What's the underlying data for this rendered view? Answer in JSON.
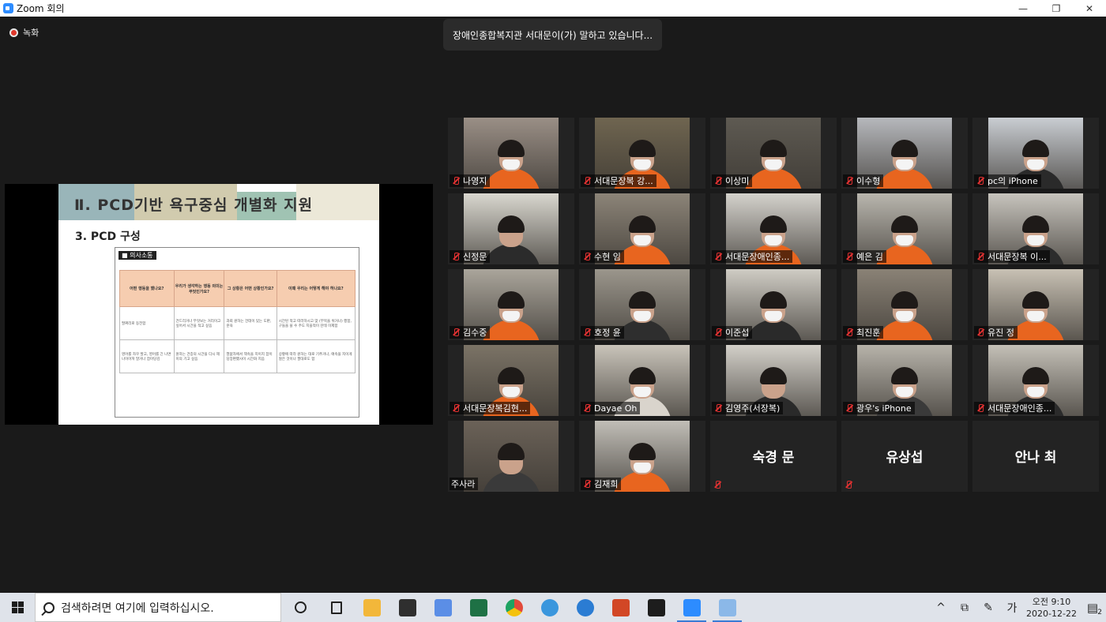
{
  "window": {
    "title": "Zoom 회의",
    "controls": [
      "—",
      "❐",
      "✕"
    ]
  },
  "recording": {
    "label": "녹화"
  },
  "speaking_banner": "장애인종합복지관 서대문이(가) 말하고 있습니다...",
  "shared_screen": {
    "slide_title": "Ⅱ. PCD기반 욕구중심 개별화 지원",
    "slide_subtitle": "3. PCD 구성",
    "box_tag": "■ 의사소통",
    "table_headers": [
      "어떤 행동을 했나요?",
      "우리가 생각하는 행동 의미는 무엇인가요?",
      "그 상황은 어떤 상황인가요?",
      "이때 우리는 어떻게 해야 하나요?"
    ],
    "table_rows": [
      [
        "팔짜리로 동전함",
        "건드리거나 무엇보는 거리이고 싶어서 시간을 적고 싶음",
        "과회 원하는 건데이 있는 도판, 훈육",
        "시간된 적고 따라하시고 맞 (부목을 위거나) 행함, 구들을 쓸 수 주도 지을적이 잔테 이제함"
      ],
      [
        "영어를 자꾸 발고, 영어를 긴 나면 나이어져 말거나 잡아당김",
        "원하는 건증의 시간을 다시 헤이의 기고 싶음",
        "열없자에서 잭속을 지이지 잡이 당장편했사이 시간화 지음",
        "상황에 따라 원하는 대로 기추거나, 애속을 지이게 않은 것이나 팔대로도 함"
      ]
    ]
  },
  "participants": [
    {
      "name": "나영지",
      "muted": true,
      "video": true,
      "bg": "#9a8f86",
      "shirt": "#e8651f",
      "mask": true
    },
    {
      "name": "서대문장복 강...",
      "muted": true,
      "video": true,
      "bg": "#6f6550",
      "shirt": "#e8651f",
      "mask": true
    },
    {
      "name": "이상미",
      "muted": true,
      "video": true,
      "bg": "#5e5a52",
      "shirt": "#e8651f",
      "mask": true
    },
    {
      "name": "이수형",
      "muted": true,
      "video": true,
      "bg": "#b6b8bc",
      "shirt": "#e8651f",
      "mask": true
    },
    {
      "name": "pc의 iPhone",
      "muted": true,
      "video": true,
      "bg": "#c9cdd2",
      "shirt": "#2a2a2a",
      "mask": true
    },
    {
      "name": "신정문",
      "muted": true,
      "video": true,
      "bg": "#d9d7cf",
      "shirt": "#2b2b2b",
      "mask": false
    },
    {
      "name": "수현 임",
      "muted": true,
      "video": true,
      "bg": "#8c8478",
      "shirt": "#e8651f",
      "mask": true
    },
    {
      "name": "서대문장애인종...",
      "muted": true,
      "video": true,
      "bg": "#d4d2cc",
      "shirt": "#e8651f",
      "mask": true
    },
    {
      "name": "예은 김",
      "muted": true,
      "video": true,
      "bg": "#b9b6ae",
      "shirt": "#e8651f",
      "mask": true
    },
    {
      "name": "서대문장복 이...",
      "muted": true,
      "video": true,
      "bg": "#c7c4bd",
      "shirt": "#2c2c2c",
      "mask": true
    },
    {
      "name": "김수중",
      "muted": true,
      "video": true,
      "bg": "#aaa59b",
      "shirt": "#e8651f",
      "mask": true
    },
    {
      "name": "호정 윤",
      "muted": true,
      "video": true,
      "bg": "#9b968c",
      "shirt": "#2e2e2e",
      "mask": true
    },
    {
      "name": "이준섭",
      "muted": true,
      "video": true,
      "bg": "#cfccc4",
      "shirt": "#2a2a2a",
      "mask": true
    },
    {
      "name": "최진훈",
      "muted": true,
      "video": true,
      "bg": "#8a8276",
      "shirt": "#e8651f",
      "mask": true
    },
    {
      "name": "유진 정",
      "muted": true,
      "video": true,
      "bg": "#c8c1b4",
      "shirt": "#e8651f",
      "mask": true
    },
    {
      "name": "서대문장복김현...",
      "muted": true,
      "video": true,
      "bg": "#7b7366",
      "shirt": "#e8651f",
      "mask": true
    },
    {
      "name": "Dayae Oh",
      "muted": true,
      "video": true,
      "bg": "#c9c4ba",
      "shirt": "#d9d4cc",
      "mask": true
    },
    {
      "name": "김영주(서장복)",
      "muted": true,
      "video": true,
      "bg": "#d3d0c9",
      "shirt": "#2a2a2a",
      "mask": false
    },
    {
      "name": "광우's iPhone",
      "muted": true,
      "video": true,
      "bg": "#b7b3aa",
      "shirt": "#3a3a3a",
      "mask": true
    },
    {
      "name": "서대문장애인종...",
      "muted": true,
      "video": true,
      "bg": "#c4c0b7",
      "shirt": "#2b2b2b",
      "mask": true
    },
    {
      "name": "주사라",
      "muted": false,
      "video": true,
      "bg": "#6b6258",
      "shirt": "#3a3a3a",
      "mask": false
    },
    {
      "name": "김재희",
      "muted": true,
      "video": true,
      "bg": "#c1beb7",
      "shirt": "#e8651f",
      "mask": true
    },
    {
      "name": "숙경 문",
      "muted": true,
      "video": false
    },
    {
      "name": "유상섭",
      "muted": true,
      "video": false
    },
    {
      "name": "안나 최",
      "muted": false,
      "video": false
    }
  ],
  "taskbar": {
    "search_placeholder": "검색하려면 여기에 입력하십시오.",
    "apps": [
      {
        "name": "cortana-icon",
        "color": "transparent"
      },
      {
        "name": "task-view-icon",
        "color": "transparent"
      },
      {
        "name": "file-explorer-icon",
        "color": "#f2b73a"
      },
      {
        "name": "store-icon",
        "color": "#2f2f2f"
      },
      {
        "name": "app-blue-icon",
        "color": "#5b8ee6"
      },
      {
        "name": "excel-icon",
        "color": "#1e7145"
      },
      {
        "name": "chrome-icon",
        "color": "#e24a3b"
      },
      {
        "name": "ie-icon",
        "color": "#3a96dd"
      },
      {
        "name": "edge-icon",
        "color": "#2b7cd3"
      },
      {
        "name": "powerpoint-icon",
        "color": "#d24726"
      },
      {
        "name": "vegas-icon",
        "color": "#1d1d1d"
      },
      {
        "name": "zoom-icon",
        "color": "#2d8cff"
      },
      {
        "name": "paint-icon",
        "color": "#8bb8e8"
      }
    ],
    "tray": {
      "chevron": "^",
      "ime": "가",
      "time": "오전 9:10",
      "date": "2020-12-22",
      "notification_count": "2"
    }
  }
}
